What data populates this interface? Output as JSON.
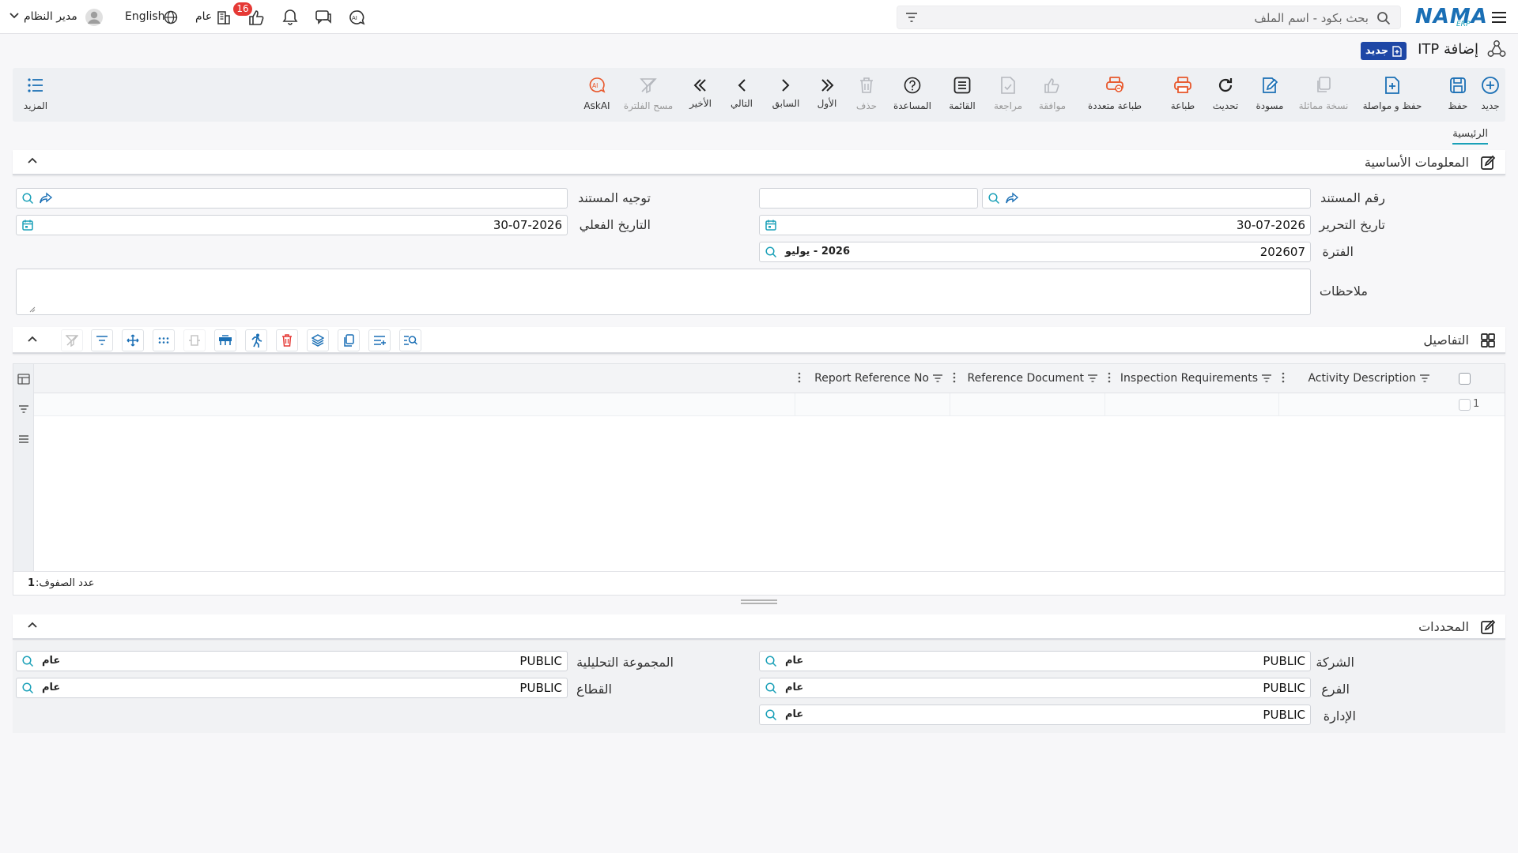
{
  "topbar": {
    "search_placeholder": "بحث بكود - اسم الملف",
    "language": "English",
    "company_label": "عام",
    "notification_count": "16",
    "user_name": "مدير النظام",
    "logo_text": "NAMA",
    "logo_sub": "ERP"
  },
  "page": {
    "title": "إضافة ITP",
    "badge": "جديد"
  },
  "toolbar": {
    "new": "جديد",
    "save": "حفظ",
    "save_continue": "حفظ و مواصلة",
    "duplicate": "نسخة مماثلة",
    "draft": "مسودة",
    "refresh": "تحديث",
    "print": "طباعة",
    "multi_print": "طباعة متعددة",
    "approve": "موافقة",
    "review": "مراجعة",
    "list": "القائمة",
    "help": "المساعدة",
    "delete": "حذف",
    "first": "الأول",
    "previous": "السابق",
    "next": "التالي",
    "last": "الأخير",
    "clear_filter": "مسح الفلترة",
    "askai": "AskAI",
    "more": "المزيد"
  },
  "tabs": {
    "main": "الرئيسية"
  },
  "basic_info": {
    "title": "المعلومات الأساسية",
    "doc_number_label": "رقم المستند",
    "doc_direction_label": "توجيه المستند",
    "edit_date_label": "تاريخ التحرير",
    "edit_date_value": "30-07-2026",
    "actual_date_label": "التاريخ الفعلي",
    "actual_date_value": "30-07-2026",
    "period_label": "الفترة",
    "period_value": "202607",
    "period_tag": "2026 - يوليو",
    "notes_label": "ملاحظات"
  },
  "details": {
    "title": "التفاصيل",
    "columns": [
      "Activity Description",
      "Inspection Requirements",
      "Reference Document",
      "Report Reference No"
    ],
    "row_number": "1",
    "row_count_label": "عدد الصفوف:",
    "row_count_value": "1"
  },
  "dimensions": {
    "title": "المحددات",
    "company_label": "الشركة",
    "company_value": "PUBLIC",
    "company_tag": "عام",
    "branch_label": "الفرع",
    "branch_value": "PUBLIC",
    "branch_tag": "عام",
    "department_label": "الإدارة",
    "department_value": "PUBLIC",
    "department_tag": "عام",
    "analytic_group_label": "المجموعة التحليلية",
    "analytic_group_value": "PUBLIC",
    "analytic_group_tag": "عام",
    "sector_label": "القطاع",
    "sector_value": "PUBLIC",
    "sector_tag": "عام"
  },
  "colors": {
    "accent": "#1aa0b8",
    "primary": "#1e47a6",
    "print_orange": "#e8572b",
    "badge_red": "#e53935"
  }
}
